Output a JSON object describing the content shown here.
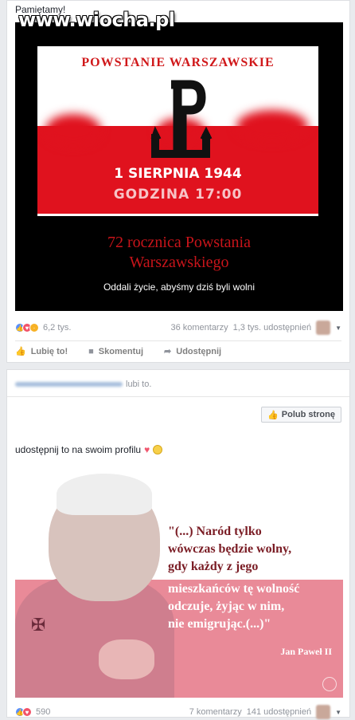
{
  "watermark": "www.wiocha.pl",
  "post1": {
    "caption": "Pamiętamy!",
    "poster": {
      "title": "POWSTANIE WARSZAWSKIE",
      "date": "1 SIERPNIA 1944",
      "hour": "GODZINA 17:00",
      "line1": "72 rocznica Powstania",
      "line2": "Warszawskiego",
      "line3": "Oddali życie, abyśmy dziś byli wolni"
    },
    "reactions_count": "6,2 tys.",
    "comments": "36 komentarzy",
    "shares": "1,3 tys. udostępnień",
    "actions": {
      "like": "Lubię to!",
      "comment": "Skomentuj",
      "share": "Udostępnij"
    }
  },
  "post2": {
    "liked_by_suffix": "lubi to.",
    "page_like_label": "Polub stronę",
    "caption": "udostępnij to na swoim profilu",
    "quote_lines": [
      "\"(...) Naród tylko",
      "wówczas będzie wolny,",
      "gdy każdy z jego",
      "mieszkańców tę wolność",
      "odczuje, żyjąc w nim,",
      "nie emigrując.(...)\""
    ],
    "quote_author": "Jan Paweł II",
    "reactions_count": "590",
    "comments": "7 komentarzy",
    "shares": "141 udostępnień"
  },
  "colors": {
    "poland_red": "#e0121e",
    "facebook_blue": "#5890ff",
    "love_red": "#f25268"
  },
  "icons": [
    "like-icon",
    "love-icon",
    "sad-icon",
    "thumb-icon",
    "comment-icon",
    "share-icon",
    "chevron-down-icon",
    "heart-icon",
    "smiley-icon"
  ]
}
